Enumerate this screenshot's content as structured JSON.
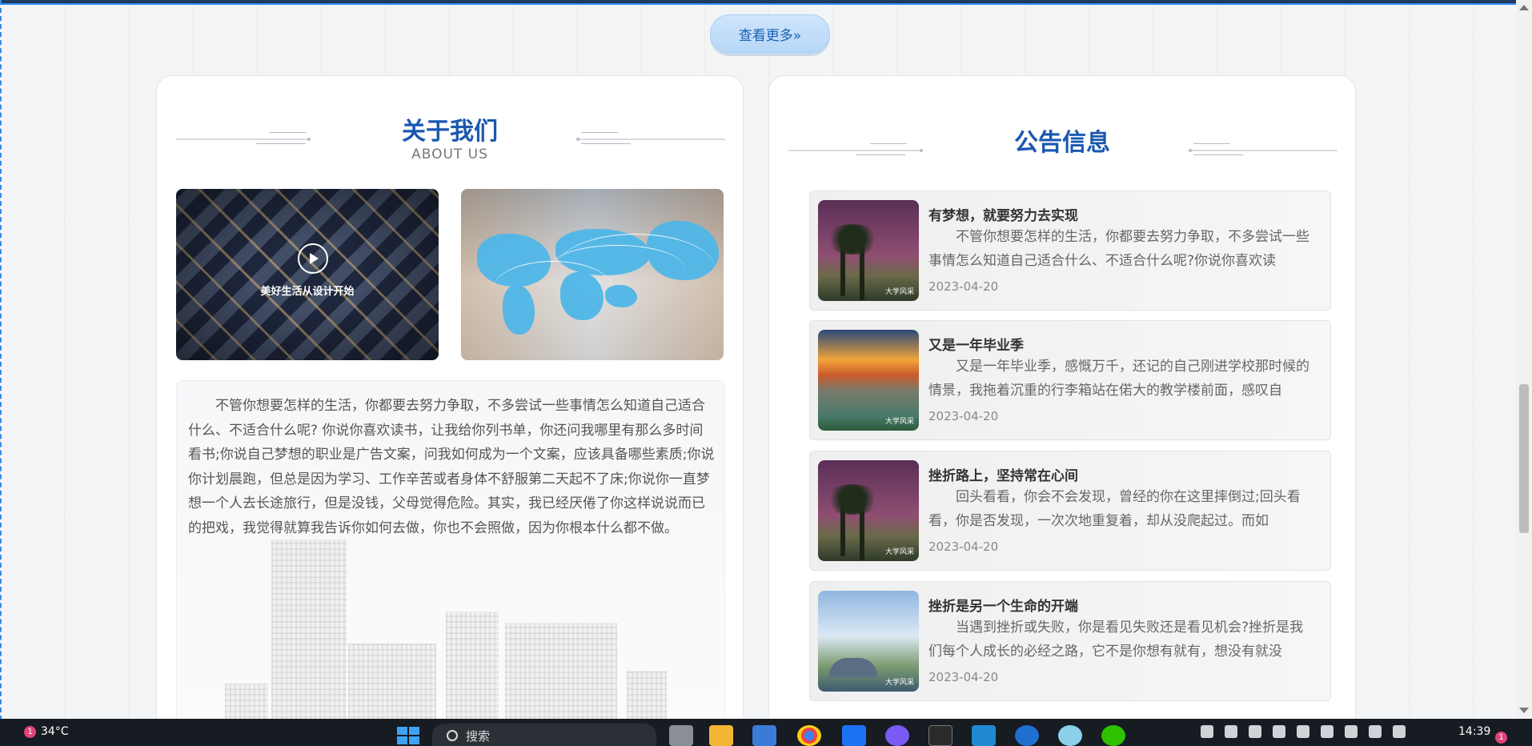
{
  "more_button": {
    "label": "查看更多»"
  },
  "about": {
    "title": "关于我们",
    "subtitle": "ABOUT US",
    "image_caption": "美好生活从设计开始",
    "paragraph": "不管你想要怎样的生活，你都要去努力争取，不多尝试一些事情怎么知道自己适合什么、不适合什么呢? 你说你喜欢读书，让我给你列书单，你还问我哪里有那么多时间看书;你说自己梦想的职业是广告文案，问我如何成为一个文案，应该具备哪些素质;你说你计划晨跑，但总是因为学习、工作辛苦或者身体不舒服第二天起不了床;你说你一直梦想一个人去长途旅行，但是没钱，父母觉得危险。其实，我已经厌倦了你这样说说而已的把戏，我觉得就算我告诉你如何去做，你也不会照做，因为你根本什么都不做。"
  },
  "notice": {
    "title": "公告信息",
    "items": [
      {
        "title": "有梦想，就要努力去实现",
        "summary": "不管你想要怎样的生活，你都要去努力争取，不多尝试一些事情怎么知道自己适合什么、不适合什么呢?你说你喜欢读",
        "date": "2023-04-20",
        "thumb_mark": "大学风采"
      },
      {
        "title": "又是一年毕业季",
        "summary": "又是一年毕业季，感慨万千，还记的自己刚进学校那时候的情景，我拖着沉重的行李箱站在偌大的教学楼前面，感叹自",
        "date": "2023-04-20",
        "thumb_mark": "大学风采"
      },
      {
        "title": "挫折路上，坚持常在心间",
        "summary": "回头看看，你会不会发现，曾经的你在这里摔倒过;回头看看，你是否发现，一次次地重复着，却从没爬起过。而如",
        "date": "2023-04-20",
        "thumb_mark": "大学风采"
      },
      {
        "title": "挫折是另一个生命的开端",
        "summary": "当遇到挫折或失败，你是看见失败还是看见机会?挫折是我们每个人成长的必经之路，它不是你想有就有，想没有就没",
        "date": "2023-04-20",
        "thumb_mark": "大学风采"
      }
    ]
  },
  "taskbar": {
    "weather_badge": "1",
    "temperature": "34°C",
    "search_placeholder": "搜索",
    "time": "14:39",
    "notification_count": "1"
  },
  "colors": {
    "accent": "#1a58b0",
    "button_bg": "#cfe5fb",
    "taskbar": "#171b22"
  }
}
